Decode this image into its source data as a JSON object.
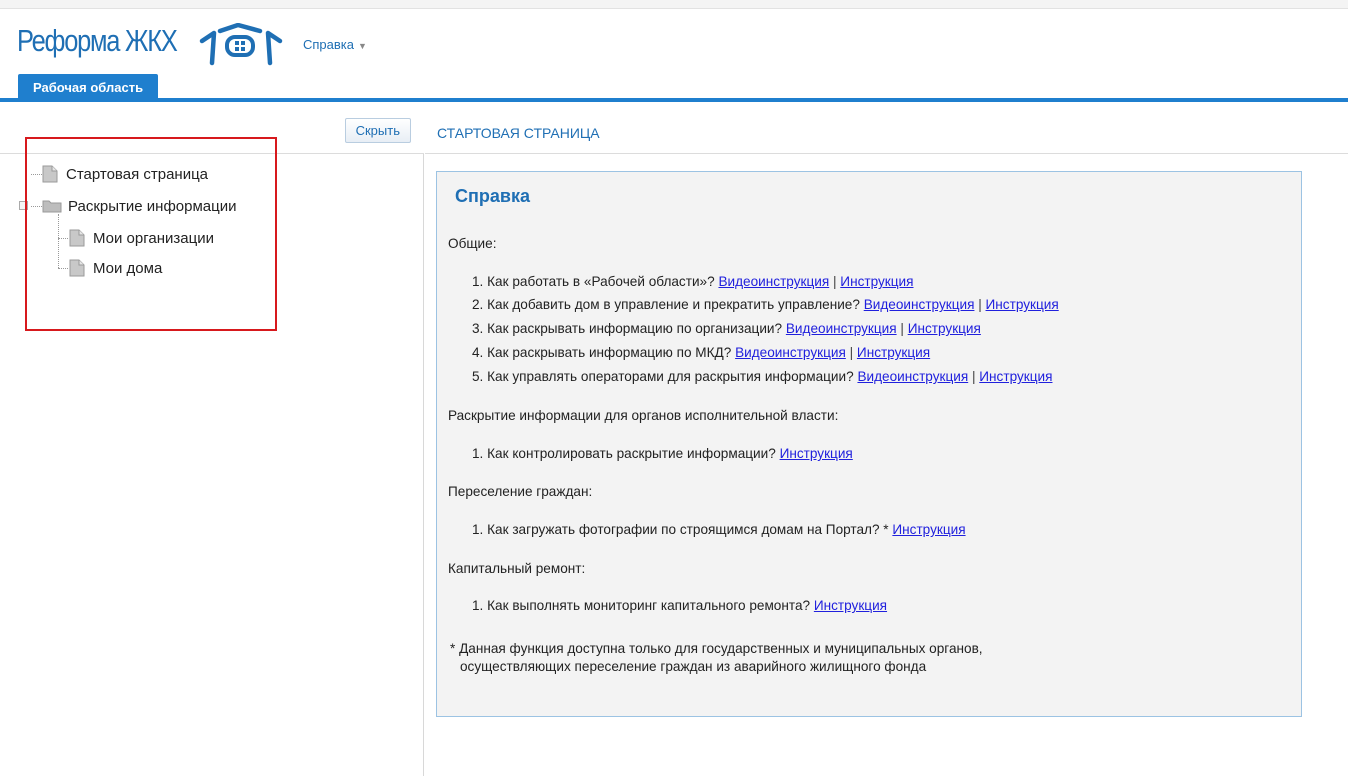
{
  "header": {
    "logo_text": "Реформа ЖКХ",
    "help_menu": "Справка",
    "caret": "▼"
  },
  "tabs": [
    {
      "label": "Рабочая область",
      "active": true
    }
  ],
  "sidebar": {
    "hide_button": "Скрыть",
    "tree": [
      {
        "label": "Стартовая страница",
        "icon": "document-icon"
      },
      {
        "label": "Раскрытие информации",
        "icon": "folder-icon",
        "children": [
          {
            "label": "Мои организации",
            "icon": "document-icon"
          },
          {
            "label": "Мои дома",
            "icon": "document-icon"
          }
        ]
      }
    ]
  },
  "content": {
    "page_title": "СТАРТОВАЯ СТРАНИЦА",
    "box_title": "Справка",
    "sections": [
      {
        "title": "Общие:",
        "items": [
          {
            "num": "1.",
            "text": "Как работать в «Рабочей области»?",
            "video": "Видеоинструкция",
            "doc": "Инструкция"
          },
          {
            "num": "2.",
            "text": "Как добавить дом в управление и прекратить управление?",
            "video": "Видеоинструкция",
            "doc": "Инструкция"
          },
          {
            "num": "3.",
            "text": "Как раскрывать информацию по организации?",
            "video": "Видеоинструкция",
            "doc": "Инструкция"
          },
          {
            "num": "4.",
            "text": "Как раскрывать информацию по МКД?",
            "video": "Видеоинструкция",
            "doc": "Инструкция"
          },
          {
            "num": "5.",
            "text": "Как управлять операторами для раскрытия информации?",
            "video": "Видеоинструкция",
            "doc": "Инструкция"
          }
        ]
      },
      {
        "title": "Раскрытие информации для органов исполнительной власти:",
        "items": [
          {
            "num": "1.",
            "text": "Как контролировать раскрытие информации?",
            "doc": "Инструкция"
          }
        ]
      },
      {
        "title": "Переселение граждан:",
        "items": [
          {
            "num": "1.",
            "text": "Как загружать фотографии по строящимся домам на Портал? *",
            "doc": "Инструкция"
          }
        ]
      },
      {
        "title": "Капитальный ремонт:",
        "items": [
          {
            "num": "1.",
            "text": "Как выполнять мониторинг капитального ремонта?",
            "doc": "Инструкция"
          }
        ]
      }
    ],
    "separator": "|",
    "note_line1": "* Данная функция доступна только для государственных и муниципальных органов,",
    "note_line2": "осуществляющих переселение граждан из аварийного жилищного фонда"
  },
  "colors": {
    "brand_blue": "#1f7fce",
    "link": "#2020dd",
    "highlight_red": "#d7191d"
  }
}
